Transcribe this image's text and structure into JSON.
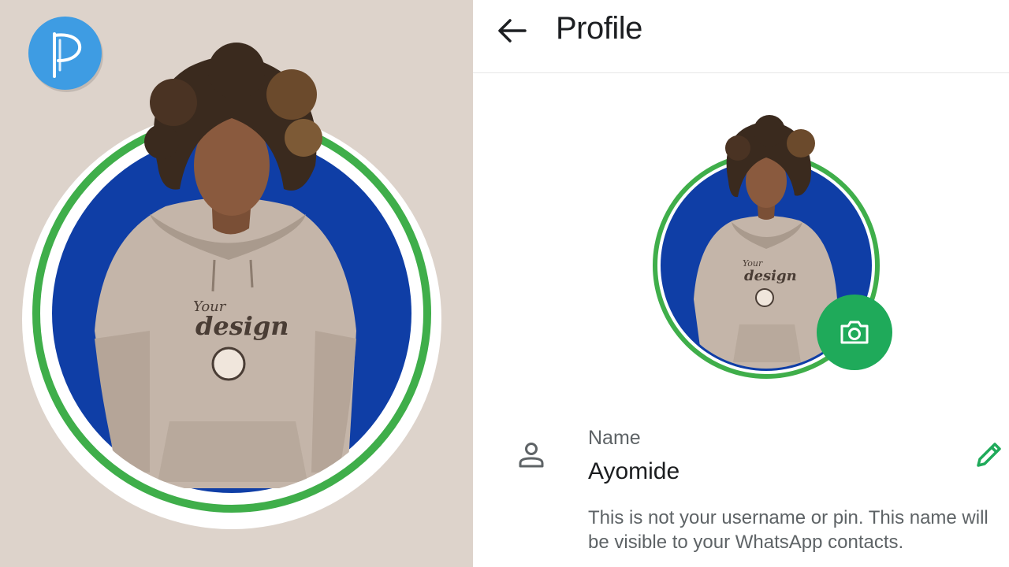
{
  "header": {
    "title": "Profile",
    "back_icon": "arrow-back-icon"
  },
  "profile": {
    "name_label": "Name",
    "name_value": "Ayomide",
    "name_hint": "This is not your username or pin. This name will be visible to your WhatsApp contacts.",
    "person_icon": "person-icon",
    "edit_icon": "pencil-icon",
    "camera_icon": "camera-icon"
  },
  "poster": {
    "logo_icon": "pixellab-logo-icon",
    "hoodie_print_top": "Your",
    "hoodie_print_main": "design"
  },
  "colors": {
    "poster_background": "#ddd3cb",
    "avatar_ring": "#3fae4a",
    "avatar_fill": "#0f3ea6",
    "accent_green": "#1faa5a",
    "logo_blue": "#3e9ce3"
  }
}
